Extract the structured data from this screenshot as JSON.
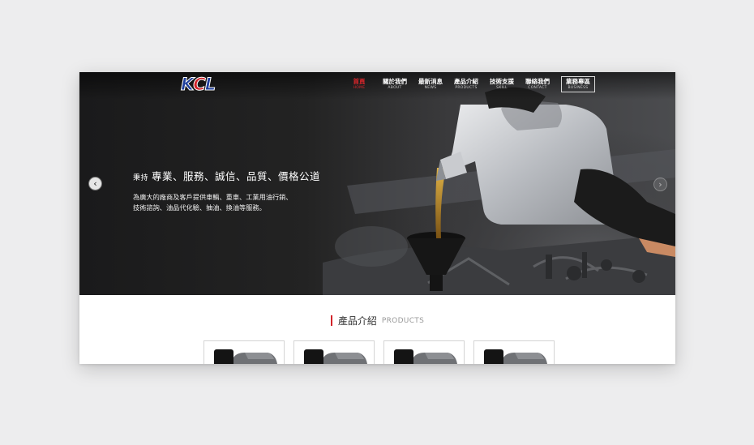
{
  "logo": {
    "k": "K",
    "c": "C",
    "l": "L"
  },
  "nav": {
    "items": [
      {
        "zh": "首頁",
        "en": "HOME",
        "active": true
      },
      {
        "zh": "關於我們",
        "en": "ABOUT"
      },
      {
        "zh": "最新消息",
        "en": "NEWS"
      },
      {
        "zh": "產品介紹",
        "en": "PRODUCTS"
      },
      {
        "zh": "技術支援",
        "en": "SKILL"
      },
      {
        "zh": "聯絡我們",
        "en": "CONTACT"
      },
      {
        "zh": "業務專區",
        "en": "BUSINESS",
        "boxed": true
      }
    ]
  },
  "hero": {
    "slogan_prefix": "秉持",
    "slogan_main": "專業、服務、誠信、品質、價格公道",
    "desc_line1": "為廣大的廠商及客戶提供車輛、重車、工業用油行銷、",
    "desc_line2": "技術諮詢、油品代化驗、抽油、換油等服務。",
    "arrow_left": "‹",
    "arrow_right": "›"
  },
  "products": {
    "title_zh": "產品介紹",
    "title_en": "PRODUCTS",
    "card_count": 4
  },
  "colors": {
    "accent": "#d2232a",
    "brand_blue": "#1f3f9c",
    "background": "#ededee"
  }
}
